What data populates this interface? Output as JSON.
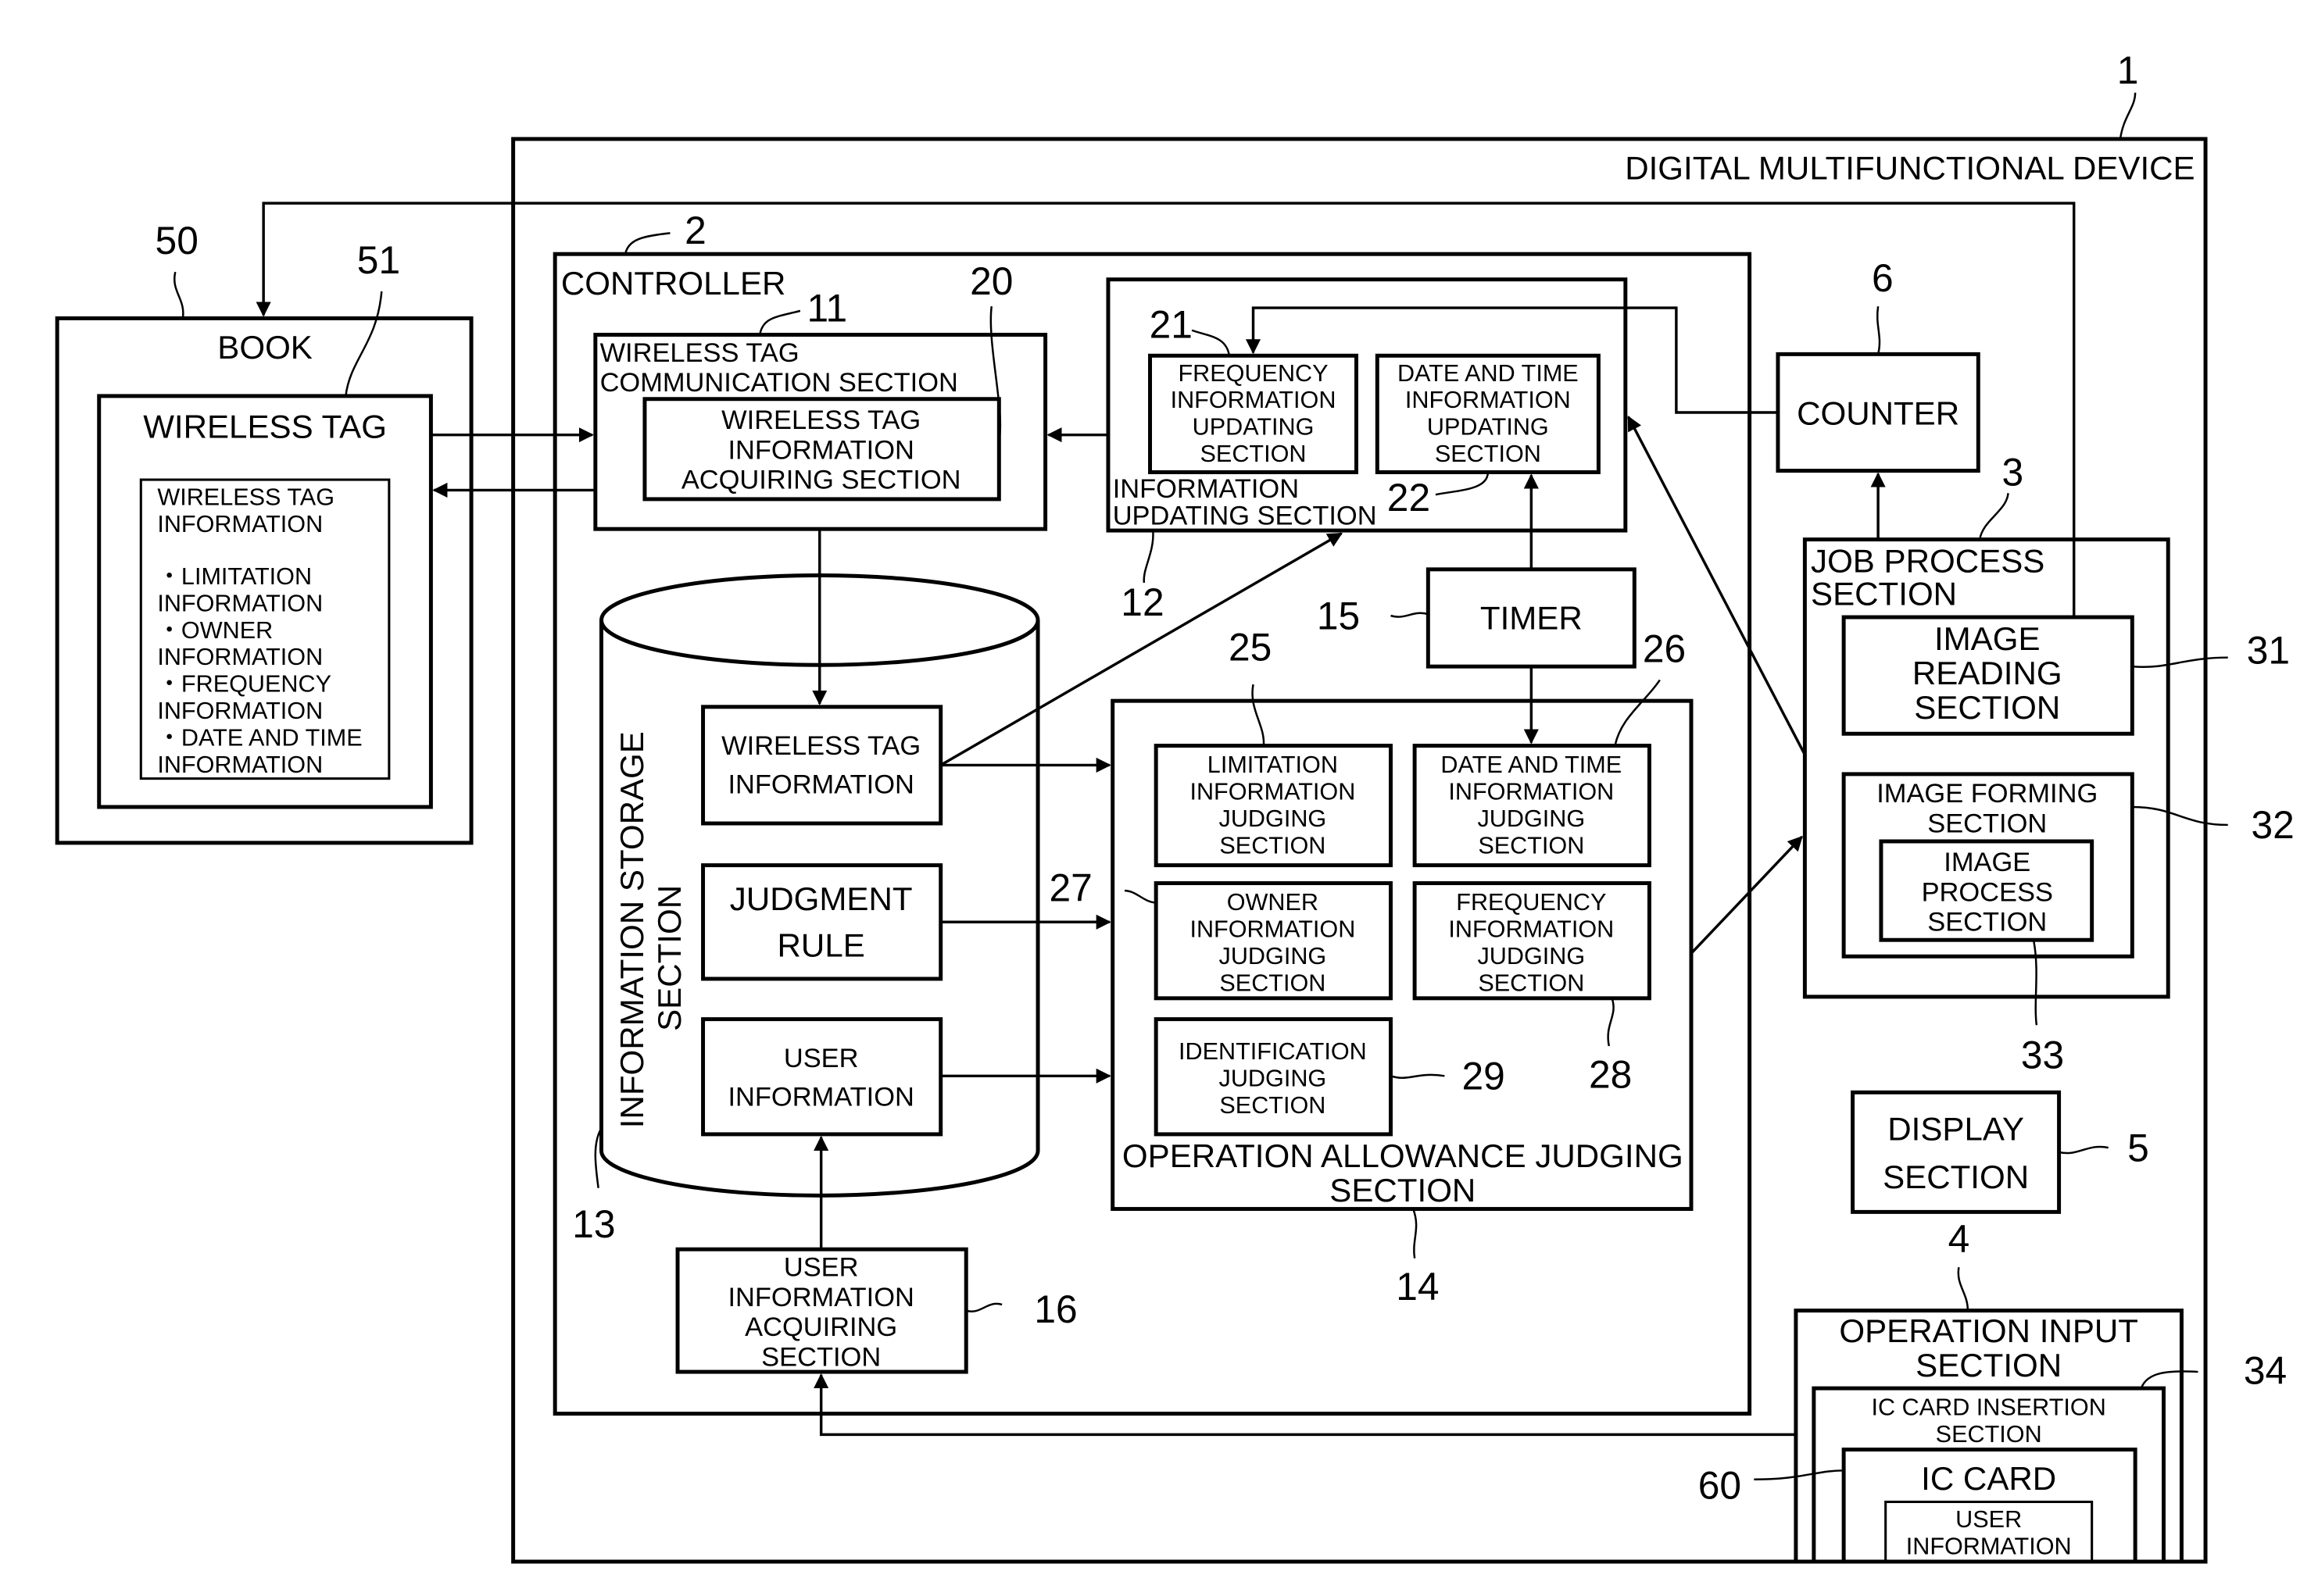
{
  "figure": {
    "device": {
      "ref": "1",
      "title": "DIGITAL MULTIFUNCTIONAL DEVICE"
    },
    "book": {
      "ref": "50",
      "title": "BOOK",
      "wireless_tag": {
        "ref": "51",
        "title": "WIRELESS TAG",
        "info_box": {
          "lines": [
            "WIRELESS TAG",
            "INFORMATION",
            "",
            "・LIMITATION",
            "INFORMATION",
            "・OWNER",
            "INFORMATION",
            "・FREQUENCY",
            "INFORMATION",
            "・DATE AND TIME",
            "INFORMATION"
          ]
        }
      }
    },
    "controller": {
      "ref": "2",
      "title": "CONTROLLER",
      "comm_section": {
        "ref": "11",
        "lines": [
          "WIRELESS TAG",
          "COMMUNICATION SECTION"
        ],
        "acquiring": {
          "ref": "20",
          "lines": [
            "WIRELESS TAG",
            "INFORMATION",
            "ACQUIRING SECTION"
          ]
        }
      },
      "updating_section": {
        "ref": "12",
        "lines": [
          "INFORMATION",
          "UPDATING SECTION"
        ],
        "frequency": {
          "ref": "21",
          "lines": [
            "FREQUENCY",
            "INFORMATION",
            "UPDATING",
            "SECTION"
          ]
        },
        "datetime": {
          "ref": "22",
          "lines": [
            "DATE AND TIME",
            "INFORMATION",
            "UPDATING",
            "SECTION"
          ]
        }
      },
      "storage": {
        "ref": "13",
        "lines": [
          "INFORMATION STORAGE",
          "SECTION"
        ],
        "items": [
          {
            "lines": [
              "WIRELESS TAG",
              "INFORMATION"
            ]
          },
          {
            "lines": [
              "JUDGMENT",
              "RULE"
            ]
          },
          {
            "lines": [
              "USER",
              "INFORMATION"
            ]
          }
        ]
      },
      "timer": {
        "ref": "15",
        "label": "TIMER"
      },
      "judging": {
        "ref": "14",
        "lines": [
          "OPERATION ALLOWANCE JUDGING",
          "SECTION"
        ],
        "limitation": {
          "ref": "25",
          "lines": [
            "LIMITATION",
            "INFORMATION",
            "JUDGING",
            "SECTION"
          ]
        },
        "datetime": {
          "ref": "26",
          "lines": [
            "DATE AND TIME",
            "INFORMATION",
            "JUDGING",
            "SECTION"
          ]
        },
        "owner": {
          "ref": "27",
          "lines": [
            "OWNER",
            "INFORMATION",
            "JUDGING",
            "SECTION"
          ]
        },
        "frequency": {
          "ref": "28",
          "lines": [
            "FREQUENCY",
            "INFORMATION",
            "JUDGING",
            "SECTION"
          ]
        },
        "identification": {
          "ref": "29",
          "lines": [
            "IDENTIFICATION",
            "JUDGING",
            "SECTION"
          ]
        }
      },
      "user_acquiring": {
        "ref": "16",
        "lines": [
          "USER",
          "INFORMATION",
          "ACQUIRING",
          "SECTION"
        ]
      }
    },
    "counter": {
      "ref": "6",
      "label": "COUNTER"
    },
    "job_process": {
      "ref": "3",
      "lines": [
        "JOB PROCESS",
        "SECTION"
      ],
      "image_reading": {
        "ref": "31",
        "lines": [
          "IMAGE",
          "READING",
          "SECTION"
        ]
      },
      "image_forming": {
        "ref": "32",
        "lines": [
          "IMAGE FORMING",
          "SECTION"
        ],
        "image_process": {
          "ref": "33",
          "lines": [
            "IMAGE",
            "PROCESS",
            "SECTION"
          ]
        }
      }
    },
    "display": {
      "ref": "5",
      "lines": [
        "DISPLAY",
        "SECTION"
      ]
    },
    "operation_input": {
      "ref": "4",
      "lines": [
        "OPERATION INPUT",
        "SECTION"
      ],
      "ic_insertion": {
        "ref": "34",
        "lines": [
          "IC CARD INSERTION",
          "SECTION"
        ],
        "ic_card": {
          "ref": "60",
          "label": "IC CARD",
          "user_info": {
            "lines": [
              "USER",
              "INFORMATION"
            ]
          }
        }
      }
    }
  }
}
